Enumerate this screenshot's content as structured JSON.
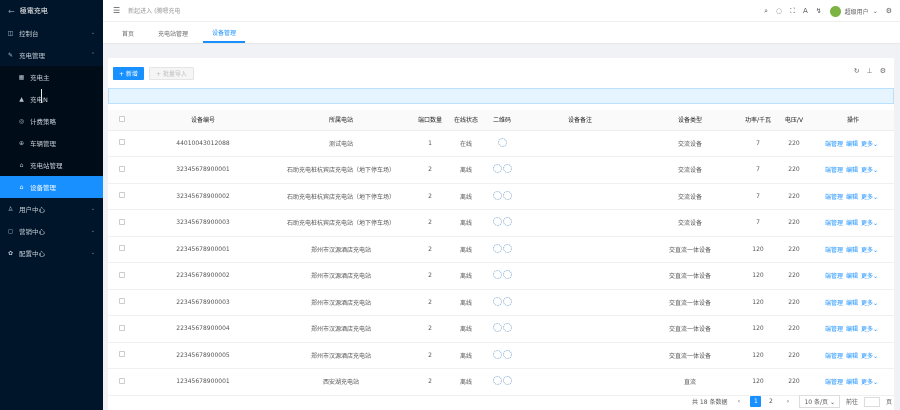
{
  "app": {
    "logo_mark": "←",
    "title": "極電充电"
  },
  "sidebar": {
    "items": [
      {
        "label": "控制台",
        "icon": "◫",
        "chev": "⌄"
      },
      {
        "label": "充电管理",
        "icon": "✎",
        "chev": "⌃"
      }
    ],
    "sub_items": [
      {
        "label": "充电主",
        "icon": "▦"
      },
      {
        "label": "充电N",
        "icon": "▲"
      },
      {
        "label": "计费策略",
        "icon": "◎"
      },
      {
        "label": "车辆管理",
        "icon": "⊕"
      },
      {
        "label": "充电站管理",
        "icon": "⌂"
      },
      {
        "label": "设备管理",
        "icon": "⌂",
        "active": true
      }
    ],
    "bottom_items": [
      {
        "label": "用户中心",
        "icon": "♙",
        "chev": "⌄"
      },
      {
        "label": "营销中心",
        "icon": "◻",
        "chev": "⌄"
      },
      {
        "label": "配置中心",
        "icon": "✿",
        "chev": "⌄"
      }
    ]
  },
  "header": {
    "menu_icon": "☰",
    "search_placeholder": "新起进入 (腾嗯充电",
    "icons": [
      "⌕",
      "◌",
      "⛶",
      "A",
      "↯"
    ],
    "user_name": "超级用户",
    "user_chev": "⌄",
    "settings_icon": "⚙"
  },
  "tabs": [
    {
      "label": "首页"
    },
    {
      "label": "充电站管理"
    },
    {
      "label": "设备管理",
      "active": true
    }
  ],
  "toolbar": {
    "add_label": "+ 新增",
    "import_label": "+ 批量导入",
    "icons": [
      "↻",
      "⊥",
      "⚙"
    ]
  },
  "table": {
    "headers": [
      "",
      "设备编号",
      "所属电站",
      "端口数量",
      "在线状态",
      "二维码",
      "设备备注",
      "设备类型",
      "功率/千瓦",
      "电压/V",
      "操作"
    ],
    "rows": [
      {
        "id": "44010043012088",
        "station": "测试电站",
        "ports": "1",
        "status": "在线",
        "qr": "single",
        "note": "",
        "type": "交流设备",
        "power": "7",
        "voltage": "220"
      },
      {
        "id": "32345678900001",
        "station": "石助充电桩杭宾店充电站（地下停车场）",
        "ports": "2",
        "status": "离线",
        "qr": "double",
        "note": "",
        "type": "交流设备",
        "power": "7",
        "voltage": "220"
      },
      {
        "id": "32345678900002",
        "station": "石助充电桩杭宾店充电站（地下停车场）",
        "ports": "2",
        "status": "离线",
        "qr": "double",
        "note": "",
        "type": "交流设备",
        "power": "7",
        "voltage": "220"
      },
      {
        "id": "32345678900003",
        "station": "石助充电桩杭宾店充电站（地下停车场）",
        "ports": "2",
        "status": "离线",
        "qr": "double",
        "note": "",
        "type": "交流设备",
        "power": "7",
        "voltage": "220"
      },
      {
        "id": "22345678900001",
        "station": "郑州市汉源酒店充电站",
        "ports": "2",
        "status": "离线",
        "qr": "double",
        "note": "",
        "type": "交直流一体设备",
        "power": "120",
        "voltage": "220"
      },
      {
        "id": "22345678900002",
        "station": "郑州市汉源酒店充电站",
        "ports": "2",
        "status": "离线",
        "qr": "double",
        "note": "",
        "type": "交直流一体设备",
        "power": "120",
        "voltage": "220"
      },
      {
        "id": "22345678900003",
        "station": "郑州市汉源酒店充电站",
        "ports": "2",
        "status": "离线",
        "qr": "double",
        "note": "",
        "type": "交直流一体设备",
        "power": "120",
        "voltage": "220"
      },
      {
        "id": "22345678900004",
        "station": "郑州市汉源酒店充电站",
        "ports": "2",
        "status": "离线",
        "qr": "double",
        "note": "",
        "type": "交直流一体设备",
        "power": "120",
        "voltage": "220"
      },
      {
        "id": "22345678900005",
        "station": "郑州市汉源酒店充电站",
        "ports": "2",
        "status": "离线",
        "qr": "double",
        "note": "",
        "type": "交直流一体设备",
        "power": "120",
        "voltage": "220"
      },
      {
        "id": "12345678900001",
        "station": "西安湖充电站",
        "ports": "2",
        "status": "离线",
        "qr": "double",
        "note": "",
        "type": "直流",
        "power": "120",
        "voltage": "220"
      }
    ],
    "ops": [
      "端管理",
      "编辑",
      "更多⌄"
    ]
  },
  "pagination": {
    "total_label": "共 18 条数据",
    "prev": "‹",
    "pages": [
      "1",
      "2"
    ],
    "current": "1",
    "next": "›",
    "page_size": "10 条/页 ⌄",
    "jump_label": "前往",
    "jump_suffix": "页"
  }
}
